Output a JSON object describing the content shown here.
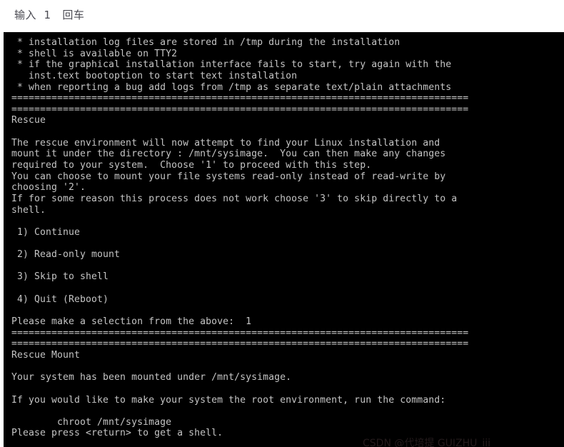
{
  "header": {
    "annotation": "输入  1   回车"
  },
  "terminal": {
    "background": "#000000",
    "foreground": "#c5c5c5",
    "columns": 80,
    "separator": "================================================================================",
    "lines": [
      " * installation log files are stored in /tmp during the installation",
      " * shell is available on TTY2",
      " * if the graphical installation interface fails to start, try again with the",
      "   inst.text bootoption to start text installation",
      " * when reporting a bug add logs from /tmp as separate text/plain attachments",
      "================================================================================",
      "================================================================================",
      "Rescue",
      "",
      "The rescue environment will now attempt to find your Linux installation and",
      "mount it under the directory : /mnt/sysimage.  You can then make any changes",
      "required to your system.  Choose '1' to proceed with this step.",
      "You can choose to mount your file systems read-only instead of read-write by",
      "choosing '2'.",
      "If for some reason this process does not work choose '3' to skip directly to a",
      "shell.",
      "",
      " 1) Continue",
      "",
      " 2) Read-only mount",
      "",
      " 3) Skip to shell",
      "",
      " 4) Quit (Reboot)",
      "",
      "Please make a selection from the above:  1",
      "================================================================================",
      "================================================================================",
      "Rescue Mount",
      "",
      "Your system has been mounted under /mnt/sysimage.",
      "",
      "If you would like to make your system the root environment, run the command:",
      "",
      "        chroot /mnt/sysimage",
      "Please press <return> to get a shell."
    ],
    "menu_options": [
      {
        "key": "1",
        "label": "Continue"
      },
      {
        "key": "2",
        "label": "Read-only mount"
      },
      {
        "key": "3",
        "label": "Skip to shell"
      },
      {
        "key": "4",
        "label": "Quit (Reboot)"
      }
    ],
    "prompt": {
      "text": "Please make a selection from the above:",
      "value": "1"
    },
    "sections": [
      {
        "title": "Rescue"
      },
      {
        "title": "Rescue Mount"
      }
    ],
    "chroot_command": "chroot /mnt/sysimage",
    "final_prompt": "Please press <return> to get a shell."
  },
  "bottom_remnant": {
    "text": "CSDN @代培提 GUIZHU_iii"
  }
}
